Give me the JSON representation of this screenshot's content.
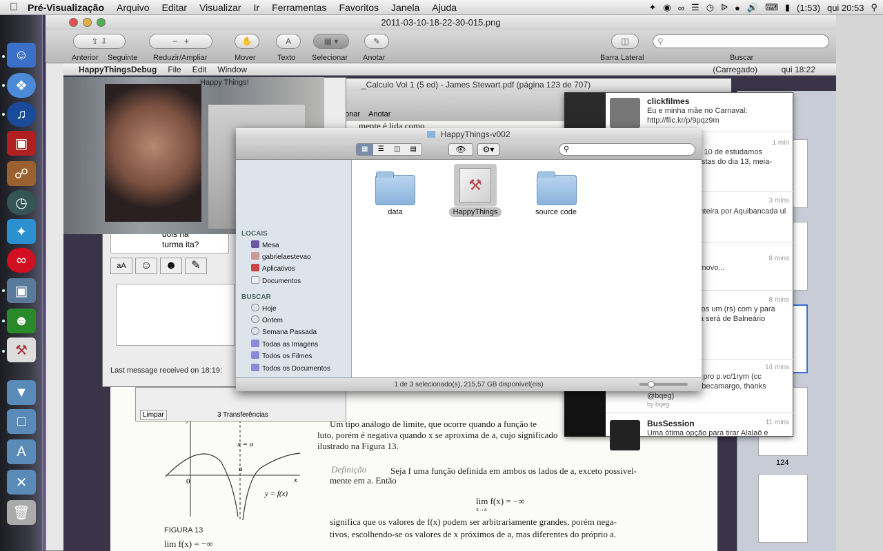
{
  "menubar": {
    "app": "Pré-Visualização",
    "items": [
      "Arquivo",
      "Editar",
      "Visualizar",
      "Ir",
      "Ferramentas",
      "Favoritos",
      "Janela",
      "Ajuda"
    ],
    "battery": "(1:53)",
    "clock": "qui 20:53"
  },
  "preview": {
    "title": "2011-03-10-18-22-30-015.png",
    "toolbar": {
      "previous": "Anterior",
      "next": "Seguinte",
      "zoom": "Reduzir/Ampliar",
      "move": "Mover",
      "text": "Texto",
      "select": "Selecionar",
      "annotate": "Anotar",
      "sidebar": "Barra Lateral",
      "search": "Buscar"
    }
  },
  "inner": {
    "menubar": {
      "app": "HappyThingsDebug",
      "items": [
        "File",
        "Edit",
        "Window"
      ],
      "battery": "(Carregado)",
      "clock": "qui 18:22"
    },
    "pdf": {
      "title": "_Calculo Vol 1 (5 ed) - James Stewart.pdf (página 123 de 707)",
      "select": "Selecionar",
      "annotate": "Anotar",
      "line_top": "mente é lida como",
      "para1": "Um tipo análogo de limite, que ocorre quando a função te",
      "para2": "luto, porém é negativa quando x se aproxima de a, cujo significado",
      "para3": "ilustrado na Figura 13.",
      "def_label": "Definição",
      "def1": "Seja f uma função definida em ambos os lados de a, exceto possivel-",
      "def2": "mente em a. Então",
      "formula": "lim f(x) = −∞",
      "formula_sub": "x→a",
      "sig1": "significa que os valores de f(x) podem ser arbitrariamente grandes, porém nega-",
      "sig2": "tivos, escolhendo-se os valores de x próximos de a, mas diferentes do próprio a.",
      "figure": "FIGURA 13",
      "fig_bottom": "lim f(x) = −∞",
      "graph_xa": "x = a",
      "graph_a": "a",
      "graph_zero": "0",
      "graph_x": "x",
      "graph_y": "y",
      "graph_fx": "y = f(x)",
      "page_number": "124"
    },
    "chat": {
      "title": "Happy Things!",
      "text1": "dois na",
      "text2": "turma ita?",
      "status": "Last message received on 18:19:",
      "clear": "Limpar",
      "transfers": "3 Transferências"
    },
    "finder": {
      "title": "HappyThings-v002",
      "status": "1 de 3 selecionado(s), 215,57 GB disponível(eis)",
      "sidebar": {
        "places_head": "LOCAIS",
        "places": [
          "Mesa",
          "gabrielaestevao",
          "Aplicativos",
          "Documentos"
        ],
        "search_head": "BUSCAR",
        "searches": [
          "Hoje",
          "Ontem",
          "Semana Passada",
          "Todas as Imagens",
          "Todos os Filmes",
          "Todos os Documentos"
        ]
      },
      "items": [
        "data",
        "HappyThings",
        "source code"
      ]
    },
    "twitter": {
      "tweets": [
        {
          "user": "clickfilmes",
          "time": "",
          "body": "Eu e minha mãe no Carnaval: http://flic.kr/p/9pqz9m"
        },
        {
          "user": "",
          "time": "1 min",
          "body": "ngressos U2 dia 10 de estudamos propostas por pistas do dia 13, meia-entrada."
        },
        {
          "user": "",
          "time": "3 mins",
          "body": "ys: Troco pista inteira por Aquibancada ul para dia 09/04."
        },
        {
          "user": "",
          "time": "8 mins",
          "body": "gar Fallout 3 de novo..."
        },
        {
          "user": "",
          "time": "8 mins",
          "body": "ra em SP, faremos um (rs) com y para viabilizar a saída será de Balneário"
        },
        {
          "user": "",
          "time": "14 mins",
          "body": "dia: Fico ou não pro p.vc/1rym (cc @nairbello @hebecamargo, thanks @bqeg)",
          "meta": "by bqeg"
        },
        {
          "user": "BusSession",
          "time": "11 mins",
          "body": "Uma ótima opção para tirar Alalaô e"
        }
      ]
    }
  }
}
